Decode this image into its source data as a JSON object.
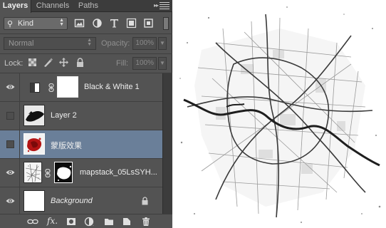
{
  "panel": {
    "tabs": [
      {
        "label": "Layers",
        "active": true
      },
      {
        "label": "Channels",
        "active": false
      },
      {
        "label": "Paths",
        "active": false
      }
    ]
  },
  "filter": {
    "kind_label": "Kind",
    "icons": [
      "image-filter-icon",
      "adjustment-filter-icon",
      "type-filter-icon",
      "shape-filter-icon",
      "smart-object-filter-icon"
    ]
  },
  "blend": {
    "mode": "Normal",
    "opacity_label": "Opacity:",
    "opacity_value": "100%"
  },
  "locks": {
    "label": "Lock:",
    "fill_label": "Fill:",
    "fill_value": "100%"
  },
  "layers": [
    {
      "name": "Black & White 1",
      "visible": true,
      "type": "adjustment",
      "selected": false
    },
    {
      "name": "Layer 2",
      "visible": false,
      "type": "pixel",
      "selected": false
    },
    {
      "name": "蒙版效果",
      "visible": false,
      "type": "pixel",
      "selected": true
    },
    {
      "name": "mapstack_05LsSYH...",
      "visible": true,
      "type": "masked",
      "selected": false
    },
    {
      "name": "Background",
      "visible": true,
      "type": "background",
      "locked": true,
      "selected": false
    }
  ],
  "colors": {
    "panel_bg": "#535353",
    "selected_row": "#6a7f99",
    "tab_bar": "#3c3c3c",
    "canvas": "#ffffff"
  }
}
